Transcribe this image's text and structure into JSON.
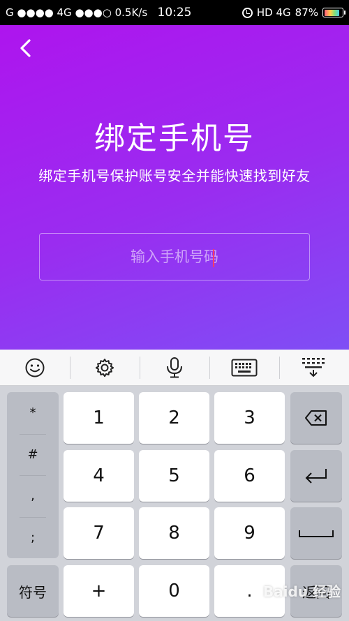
{
  "status_bar": {
    "carrier": "G ●●●● 4G ●●●○",
    "speed": "0.5K/s",
    "time": "10:25",
    "network": "HD 4G",
    "battery": "87%"
  },
  "header": {
    "title": "绑定手机号",
    "subtitle": "绑定手机号保护账号安全并能快速找到好友"
  },
  "phone_input": {
    "placeholder": "输入手机号码",
    "value": ""
  },
  "toolbar": {
    "items": [
      "emoji-icon",
      "gear-icon",
      "microphone-icon",
      "keyboard-icon",
      "collapse-keyboard-icon"
    ]
  },
  "keyboard": {
    "symbols": [
      "*",
      "#",
      ",",
      ";"
    ],
    "digits": [
      "1",
      "2",
      "3",
      "4",
      "5",
      "6",
      "7",
      "8",
      "9"
    ],
    "symbols_key": "符号",
    "plus": "+",
    "zero": "0",
    "dot": ".",
    "return_key": "返回"
  },
  "watermark": "Baidu 经验",
  "colors": {
    "accent_start": "#b012ee",
    "accent_end": "#7f4ef5",
    "cursor": "#ff3b6b"
  }
}
